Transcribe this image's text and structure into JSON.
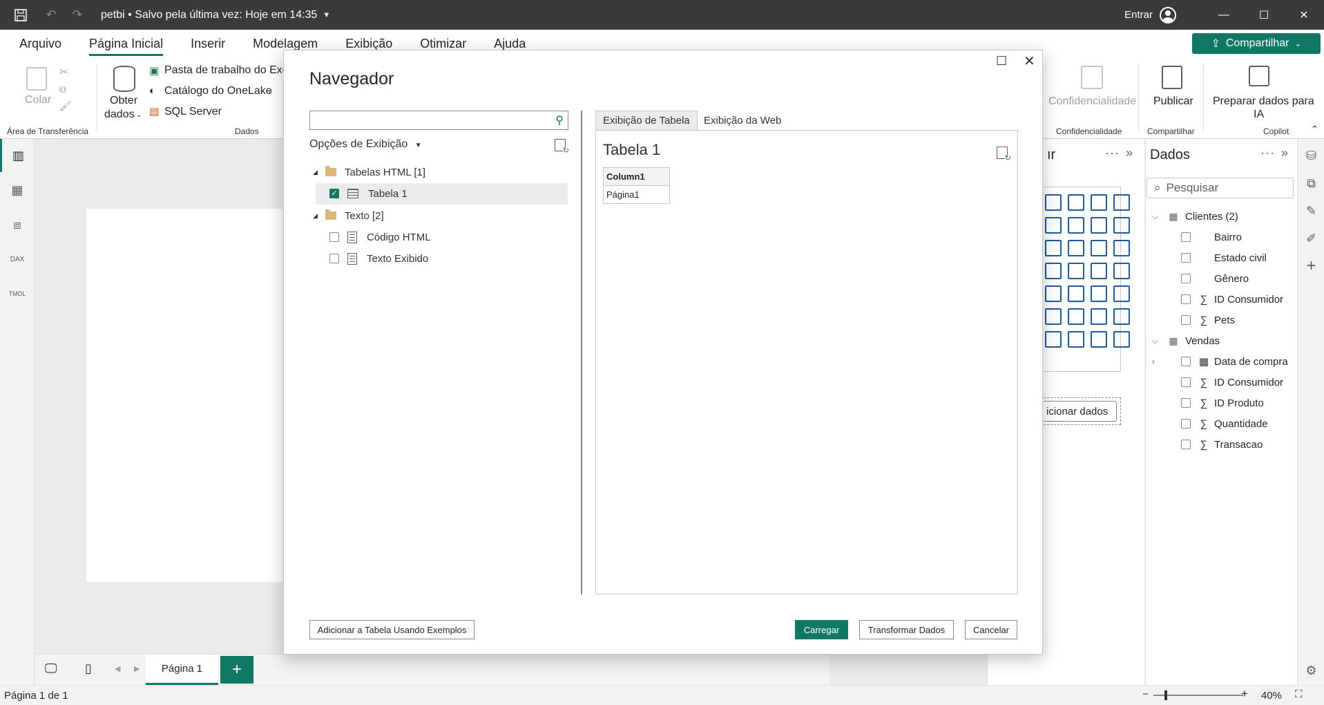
{
  "titlebar": {
    "title": "petbi • Salvo pela última vez: Hoje em 14:35",
    "signin": "Entrar"
  },
  "ribbon_tabs": [
    "Arquivo",
    "Página Inicial",
    "Inserir",
    "Modelagem",
    "Exibição",
    "Otimizar",
    "Ajuda"
  ],
  "share_label": "Compartilhar",
  "ribbon": {
    "paste": "Colar",
    "clipboard_group": "Área de Transferência",
    "get_data_line1": "Obter",
    "get_data_line2": "dados",
    "excel": "Pasta de trabalho do Exce",
    "onelake": "Catálogo do OneLake",
    "sql": "SQL Server",
    "data_group": "Dados",
    "sensitivity": "Confidencialidade",
    "sensitivity_group": "Confidencialidade",
    "publish": "Publicar",
    "share_group": "Compartilhar",
    "prep_line1": "Preparar dados para",
    "prep_line2": "IA",
    "copilot_group": "Copilot"
  },
  "viz_pane": {
    "title_partial": "ır",
    "add_data_partial": "icionar dados"
  },
  "data_pane": {
    "title": "Dados",
    "search_placeholder": "Pesquisar",
    "tables": [
      {
        "name": "Clientes (2)",
        "fields": [
          "Bairro",
          "Estado civil",
          "Gênero",
          "ID Consumidor",
          "Pets"
        ]
      },
      {
        "name": "Vendas",
        "fields": [
          "Data de compra",
          "ID Consumidor",
          "ID Produto",
          "Quantidade",
          "Transacao"
        ]
      }
    ]
  },
  "navigator": {
    "title": "Navegador",
    "options": "Opções de Exibição",
    "tree": {
      "html_folder": "Tabelas HTML [1]",
      "table1": "Tabela 1",
      "text_folder": "Texto [2]",
      "html_code": "Código HTML",
      "displayed_text": "Texto Exibido"
    },
    "tabs": [
      "Exibição de Tabela",
      "Exibição da Web"
    ],
    "preview_title": "Tabela 1",
    "preview_table": {
      "header": "Column1",
      "cell": "Página1"
    },
    "buttons": {
      "add_examples": "Adicionar a Tabela Usando Exemplos",
      "load": "Carregar",
      "transform": "Transformar Dados",
      "cancel": "Cancelar"
    }
  },
  "page_tab": "Página 1",
  "status": {
    "page": "Página 1 de 1",
    "zoom": "40%"
  }
}
